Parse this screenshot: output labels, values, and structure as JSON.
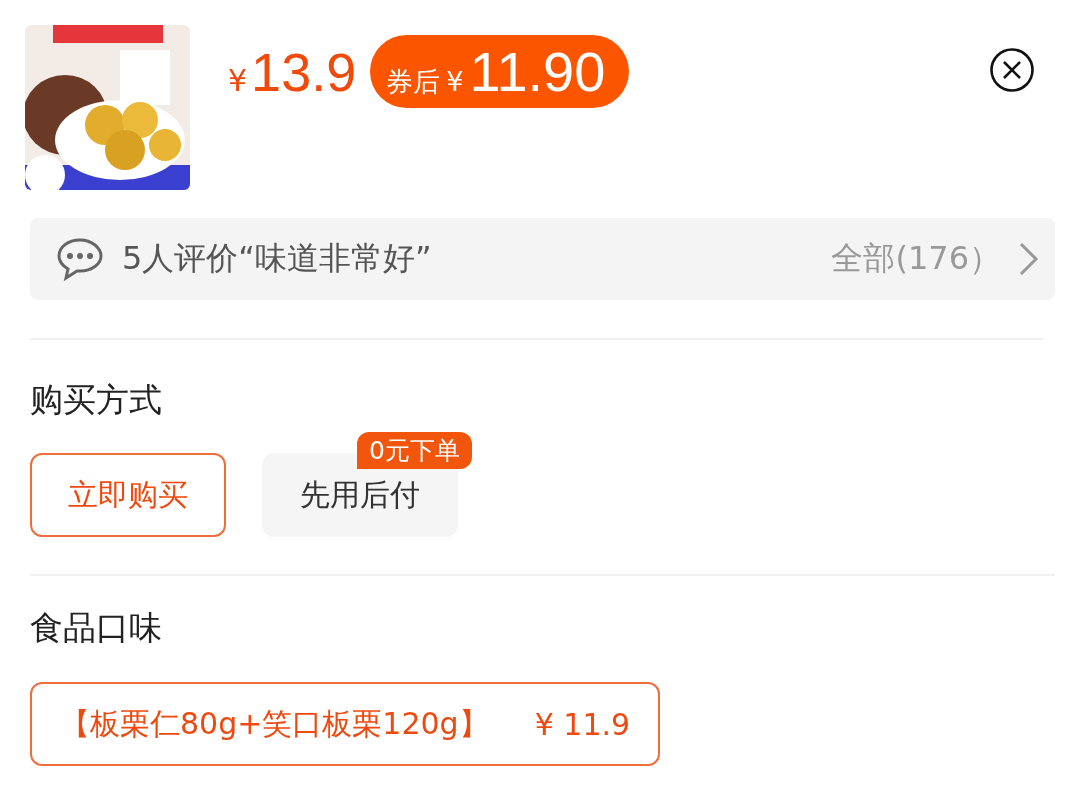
{
  "product": {
    "currency": "¥",
    "price": "13.9",
    "coupon": {
      "label": "券后",
      "currency": "¥",
      "amount": "11.90"
    }
  },
  "review": {
    "summary": "5人评价“味道非常好”",
    "all": "全部(176）"
  },
  "sections": [
    {
      "title": "购买方式",
      "options": [
        {
          "label": "立即购买",
          "selected": true
        },
        {
          "label": "先用后付",
          "selected": false,
          "badge": "0元下单"
        }
      ]
    },
    {
      "title": "食品口味",
      "options": [
        {
          "label": "【板栗仁80g+笑口板栗120g】",
          "price": "¥ 11.9",
          "selected": true
        }
      ]
    }
  ]
}
